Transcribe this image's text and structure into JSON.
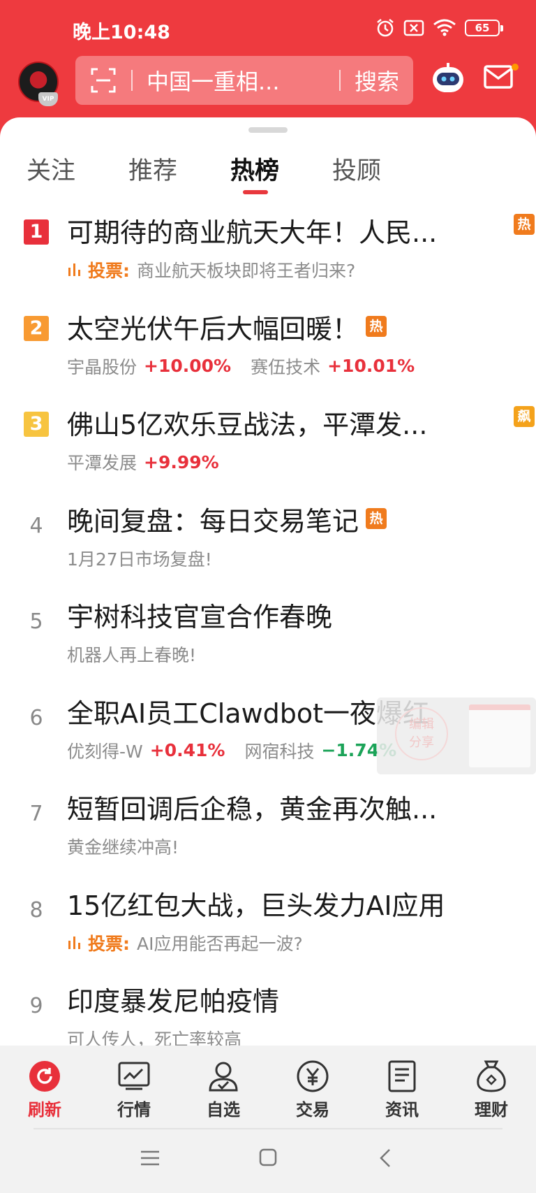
{
  "status": {
    "time": "晚上10:48",
    "battery": "65"
  },
  "header": {
    "vip_label": "VIP",
    "search_placeholder": "中国一重相...",
    "search_button": "搜索"
  },
  "tabs": [
    {
      "label": "关注"
    },
    {
      "label": "推荐"
    },
    {
      "label": "热榜"
    },
    {
      "label": "投顾"
    }
  ],
  "list": [
    {
      "rank": "1",
      "title": "可期待的商业航天大年！人民...",
      "tag": "热",
      "vote_label": "投票:",
      "sub": "商业航天板块即将王者归来?"
    },
    {
      "rank": "2",
      "title": "太空光伏午后大幅回暖！",
      "tag": "热",
      "stock1": "宇晶股份",
      "change1": "+10.00%",
      "stock2": "赛伍技术",
      "change2": "+10.01%"
    },
    {
      "rank": "3",
      "title": "佛山5亿欢乐豆战法，平潭发...",
      "tag": "飙",
      "stock1": "平潭发展",
      "change1": "+9.99%"
    },
    {
      "rank": "4",
      "title": "晚间复盘：每日交易笔记",
      "tag": "热",
      "sub": "1月27日市场复盘!"
    },
    {
      "rank": "5",
      "title": "宇树科技官宣合作春晚",
      "sub": "机器人再上春晚!"
    },
    {
      "rank": "6",
      "title": "全职AI员工Clawdbot一夜爆红",
      "stock1": "优刻得-W",
      "change1": "+0.41%",
      "stock2": "网宿科技",
      "change2": "−1.74%"
    },
    {
      "rank": "7",
      "title": "短暂回调后企稳，黄金再次触...",
      "sub": "黄金继续冲高!"
    },
    {
      "rank": "8",
      "title": "15亿红包大战，巨头发力AI应用",
      "vote_label": "投票:",
      "sub": "AI应用能否再起一波?"
    },
    {
      "rank": "9",
      "title": "印度暴发尼帕疫情",
      "sub": "可人传人，死亡率较高"
    }
  ],
  "float_card": {
    "line1": "编辑",
    "line2": "分享"
  },
  "bottom_nav": [
    {
      "label": "刷新",
      "icon": "refresh-icon"
    },
    {
      "label": "行情",
      "icon": "chart-icon"
    },
    {
      "label": "自选",
      "icon": "watchlist-icon"
    },
    {
      "label": "交易",
      "icon": "yen-icon"
    },
    {
      "label": "资讯",
      "icon": "news-icon"
    },
    {
      "label": "理财",
      "icon": "money-bag-icon"
    }
  ],
  "colors": {
    "brand_red": "#ee3a3f",
    "up": "#e8303b",
    "down": "#1ba358",
    "tag_orange": "#f07b1d"
  }
}
